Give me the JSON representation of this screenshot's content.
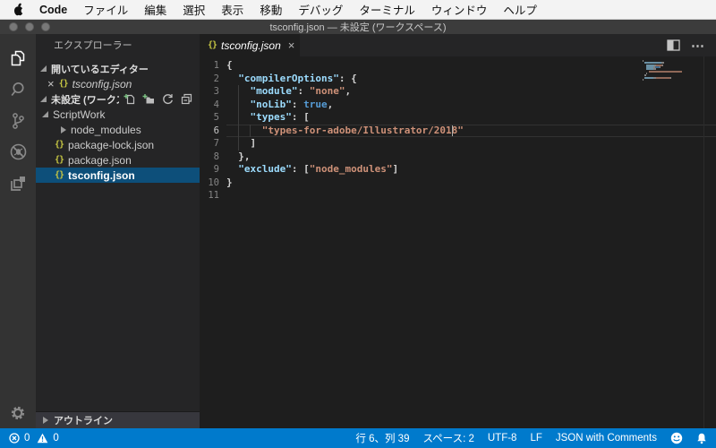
{
  "menu_bar": {
    "items": [
      "Code",
      "ファイル",
      "編集",
      "選択",
      "表示",
      "移動",
      "デバッグ",
      "ターミナル",
      "ウィンドウ",
      "ヘルプ"
    ]
  },
  "title_bar": {
    "title": "tsconfig.json — 未設定 (ワークスペース)"
  },
  "icons": {
    "close": "×",
    "json_glyph": "{}",
    "more": "⋯"
  },
  "sidebar": {
    "title": "エクスプローラー",
    "open_editors": {
      "header": "開いているエディター",
      "items": [
        {
          "name": "tsconfig.json",
          "icon": "json",
          "preview": true
        }
      ]
    },
    "workspace_section": {
      "header": "未設定 (ワークス...",
      "actions": [
        "new-file",
        "new-folder",
        "refresh",
        "collapse-all"
      ]
    },
    "tree": [
      {
        "label": "ScriptWork",
        "kind": "folder",
        "expanded": true,
        "depth": 0
      },
      {
        "label": "node_modules",
        "kind": "folder",
        "expanded": false,
        "depth": 1
      },
      {
        "label": "package-lock.json",
        "kind": "json-file",
        "depth": 1
      },
      {
        "label": "package.json",
        "kind": "json-file",
        "depth": 1
      },
      {
        "label": "tsconfig.json",
        "kind": "json-file",
        "depth": 1,
        "selected": true
      }
    ],
    "outline": {
      "header": "アウトライン"
    }
  },
  "editor": {
    "tab": {
      "label": "tsconfig.json"
    },
    "cursor": {
      "line": 6,
      "col": 39
    },
    "lines": [
      {
        "n": 1,
        "tokens": [
          [
            "p",
            "{"
          ]
        ]
      },
      {
        "n": 2,
        "tokens": [
          [
            "w",
            "  "
          ],
          [
            "k",
            "\"compilerOptions\""
          ],
          [
            "p",
            ": {"
          ]
        ]
      },
      {
        "n": 3,
        "tokens": [
          [
            "w",
            "    "
          ],
          [
            "k",
            "\"module\""
          ],
          [
            "p",
            ": "
          ],
          [
            "s",
            "\"none\""
          ],
          [
            "p",
            ","
          ]
        ]
      },
      {
        "n": 4,
        "tokens": [
          [
            "w",
            "    "
          ],
          [
            "k",
            "\"noLib\""
          ],
          [
            "p",
            ": "
          ],
          [
            "b",
            "true"
          ],
          [
            "p",
            ","
          ]
        ]
      },
      {
        "n": 5,
        "tokens": [
          [
            "w",
            "    "
          ],
          [
            "k",
            "\"types\""
          ],
          [
            "p",
            ": ["
          ]
        ]
      },
      {
        "n": 6,
        "tokens": [
          [
            "w",
            "      "
          ],
          [
            "s",
            "\"types-for-adobe/Illustrator/2018\""
          ]
        ],
        "current": true
      },
      {
        "n": 7,
        "tokens": [
          [
            "w",
            "    "
          ],
          [
            "p",
            "]"
          ]
        ]
      },
      {
        "n": 8,
        "tokens": [
          [
            "w",
            "  "
          ],
          [
            "p",
            "},"
          ]
        ]
      },
      {
        "n": 9,
        "tokens": [
          [
            "w",
            "  "
          ],
          [
            "k",
            "\"exclude\""
          ],
          [
            "p",
            ": ["
          ],
          [
            "s",
            "\"node_modules\""
          ],
          [
            "p",
            "]"
          ]
        ]
      },
      {
        "n": 10,
        "tokens": [
          [
            "p",
            "}"
          ]
        ]
      },
      {
        "n": 11,
        "tokens": []
      }
    ]
  },
  "status_bar": {
    "errors": "0",
    "warnings": "0",
    "right_items": [
      "行 6、列 39",
      "スペース: 2",
      "UTF-8",
      "LF",
      "JSON with Comments"
    ]
  },
  "colors": {
    "status_bar": "#007ACC",
    "selection": "#0D4F7A",
    "token_key": "#9CDCFE",
    "token_string": "#CE9178",
    "token_keyword": "#569CD6",
    "token_punct": "#D4D4D4",
    "json_icon": "#C5C543"
  }
}
